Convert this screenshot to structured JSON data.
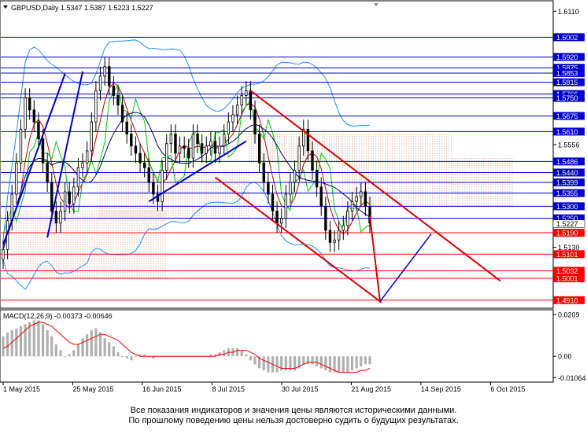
{
  "header": {
    "symbol_line": "GBPUSD,Daily  1.5347 1.5387 1.5223 1.5227"
  },
  "disclaimer": {
    "line1": "Все показания индикаторов и значения цены являются историческими данными.",
    "line2": "По прошлому поведению цены нельзя достоверно судить о будущих результатах."
  },
  "colors": {
    "level_line": "#0000cc",
    "level_label_bg": "#0000cc",
    "support_line": "#ff0000",
    "support_label_bg": "#ff0000",
    "trend_channel": "#dd0000",
    "trend_up": "#0000cc",
    "candle": "#000000",
    "bollinger": "#1e90ff",
    "envelope": "#ff4500",
    "ma_red": "#cc0000",
    "ma_green": "#00cc00",
    "ma_navy": "#000080",
    "cloud": "#d2a08c",
    "macd_hist": "#b0b0b0",
    "macd_signal": "#ff0000"
  },
  "chart_data": [
    {
      "type": "candlestick",
      "symbol": "GBPUSD",
      "timeframe": "Daily",
      "title": "GBPUSD,Daily  1.5347 1.5387 1.5223 1.5227",
      "ohlc": {
        "open": 1.5347,
        "high": 1.5387,
        "low": 1.5223,
        "close": 1.5227
      },
      "ylim": [
        1.488,
        1.615
      ],
      "y_ticks": [
        "1.6110",
        "1.5556",
        "1.5130",
        "1.4910"
      ],
      "y_tick_values": [
        1.611,
        1.5556,
        1.513,
        1.491
      ],
      "x_ticks": [
        "1 May 2015",
        "25 May 2015",
        "16 Jun 2015",
        "8 Jul 2015",
        "30 Jul 2015",
        "21 Aug 2015",
        "14 Sep 2015",
        "6 Oct 2015"
      ],
      "current_price": 1.5227,
      "resistance_levels": [
        {
          "label": "1.6002",
          "value": 1.6002
        },
        {
          "label": "1.5920",
          "value": 1.592
        },
        {
          "label": "1.5875",
          "value": 1.5875
        },
        {
          "label": "1.5853",
          "value": 1.5853
        },
        {
          "label": "1.5815",
          "value": 1.5815
        },
        {
          "label": "1.5766",
          "value": 1.5766
        },
        {
          "label": "1.5750",
          "value": 1.575
        },
        {
          "label": "1.5675",
          "value": 1.5675
        },
        {
          "label": "1.5610",
          "value": 1.561
        },
        {
          "label": "1.5486",
          "value": 1.5486
        },
        {
          "label": "1.5440",
          "value": 1.544
        },
        {
          "label": "1.5399",
          "value": 1.5399
        },
        {
          "label": "1.5355",
          "value": 1.5355
        },
        {
          "label": "1.5300",
          "value": 1.53
        },
        {
          "label": "1.5250",
          "value": 1.525
        }
      ],
      "support_levels": [
        {
          "label": "1.5190",
          "value": 1.519
        },
        {
          "label": "1.5101",
          "value": 1.5101
        },
        {
          "label": "1.5032",
          "value": 1.5032
        },
        {
          "label": "1.5001",
          "value": 1.5001
        },
        {
          "label": "1.4910",
          "value": 1.491
        }
      ],
      "closes": [
        1.512,
        1.524,
        1.535,
        1.548,
        1.562,
        1.575,
        1.57,
        1.565,
        1.558,
        1.548,
        1.54,
        1.528,
        1.523,
        1.528,
        1.536,
        1.531,
        1.538,
        1.546,
        1.548,
        1.553,
        1.565,
        1.578,
        1.584,
        1.588,
        1.58,
        1.576,
        1.572,
        1.565,
        1.56,
        1.555,
        1.552,
        1.548,
        1.546,
        1.54,
        1.535,
        1.532,
        1.545,
        1.556,
        1.56,
        1.552,
        1.555,
        1.554,
        1.55,
        1.56,
        1.556,
        1.552,
        1.555,
        1.557,
        1.552,
        1.555,
        1.56,
        1.565,
        1.568,
        1.572,
        1.576,
        1.578,
        1.57,
        1.56,
        1.548,
        1.54,
        1.535,
        1.528,
        1.523,
        1.525,
        1.535,
        1.54,
        1.545,
        1.555,
        1.562,
        1.553,
        1.545,
        1.538,
        1.53,
        1.52,
        1.515,
        1.516,
        1.52,
        1.522,
        1.528,
        1.532,
        1.534,
        1.536,
        1.53,
        1.523
      ]
    },
    {
      "type": "bar",
      "title": "MACD(12,26,9) -0.00373 -0.00646",
      "indicator": "MACD",
      "params": [
        12,
        26,
        9
      ],
      "macd": -0.00373,
      "signal": -0.00646,
      "y_ticks": [
        "0.0209",
        "0.00",
        "-0.01064"
      ],
      "ylim": [
        -0.0125,
        0.0225
      ],
      "values": [
        0.01,
        0.012,
        0.013,
        0.014,
        0.015,
        0.016,
        0.017,
        0.018,
        0.018,
        0.016,
        0.013,
        0.01,
        0.006,
        0.003,
        0.0,
        0.001,
        0.003,
        0.006,
        0.009,
        0.011,
        0.013,
        0.014,
        0.012,
        0.009,
        0.007,
        0.005,
        0.002,
        0.0,
        -0.001,
        -0.002,
        0.0,
        0.001,
        0.001,
        0.0,
        -0.001,
        0.0,
        0.0,
        0.0,
        0.0,
        0.0,
        0.0,
        0.0,
        0.0,
        0.0,
        0.0,
        0.0,
        0.0,
        0.001,
        0.001,
        0.002,
        0.003,
        0.004,
        0.004,
        0.004,
        0.003,
        0.001,
        -0.002,
        -0.004,
        -0.006,
        -0.007,
        -0.008,
        -0.008,
        -0.008,
        -0.007,
        -0.007,
        -0.007,
        -0.007,
        -0.006,
        -0.004,
        -0.004,
        -0.004,
        -0.005,
        -0.006,
        -0.007,
        -0.008,
        -0.008,
        -0.008,
        -0.008,
        -0.008,
        -0.007,
        -0.006,
        -0.005,
        -0.004,
        -0.004
      ],
      "signal_line": [
        0.004,
        0.005,
        0.007,
        0.009,
        0.011,
        0.013,
        0.015,
        0.016,
        0.017,
        0.017,
        0.016,
        0.015,
        0.013,
        0.011,
        0.009,
        0.007,
        0.006,
        0.006,
        0.007,
        0.008,
        0.009,
        0.01,
        0.011,
        0.011,
        0.01,
        0.009,
        0.008,
        0.006,
        0.004,
        0.002,
        0.001,
        0.0,
        0.0,
        0.0,
        0.0,
        0.0,
        0.0,
        0.0,
        0.0,
        0.0,
        0.0,
        0.0,
        0.0,
        0.0,
        0.0,
        0.0,
        0.0,
        0.0,
        0.0,
        0.001,
        0.001,
        0.002,
        0.002,
        0.003,
        0.003,
        0.003,
        0.002,
        0.001,
        -0.001,
        -0.002,
        -0.003,
        -0.004,
        -0.005,
        -0.006,
        -0.006,
        -0.006,
        -0.006,
        -0.005,
        -0.004,
        -0.003,
        -0.003,
        -0.003,
        -0.004,
        -0.005,
        -0.006,
        -0.007,
        -0.008,
        -0.008,
        -0.008,
        -0.008,
        -0.008,
        -0.007,
        -0.007,
        -0.006
      ]
    }
  ]
}
